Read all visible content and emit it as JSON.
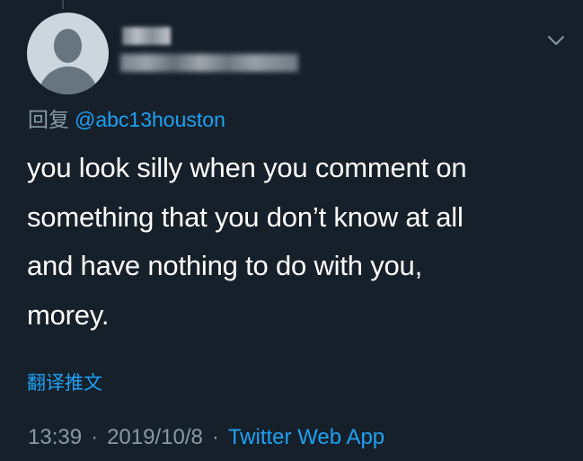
{
  "tweet": {
    "replying_prefix": "回复",
    "replying_to": "@abc13houston",
    "text_lines": [
      "you look silly when you comment on",
      "something that you don’t know at all",
      "and have nothing to do with you,",
      "morey."
    ],
    "translate_label": "翻译推文",
    "time": "13:39",
    "date": "2019/10/8",
    "separator": "·",
    "source": "Twitter Web App"
  },
  "icons": {
    "menu": "chevron-down-icon",
    "avatar": "default-avatar-icon"
  },
  "colors": {
    "background": "#15202b",
    "accent": "#1da1f2",
    "secondary_text": "#8899a6",
    "primary_text": "#ffffff"
  }
}
